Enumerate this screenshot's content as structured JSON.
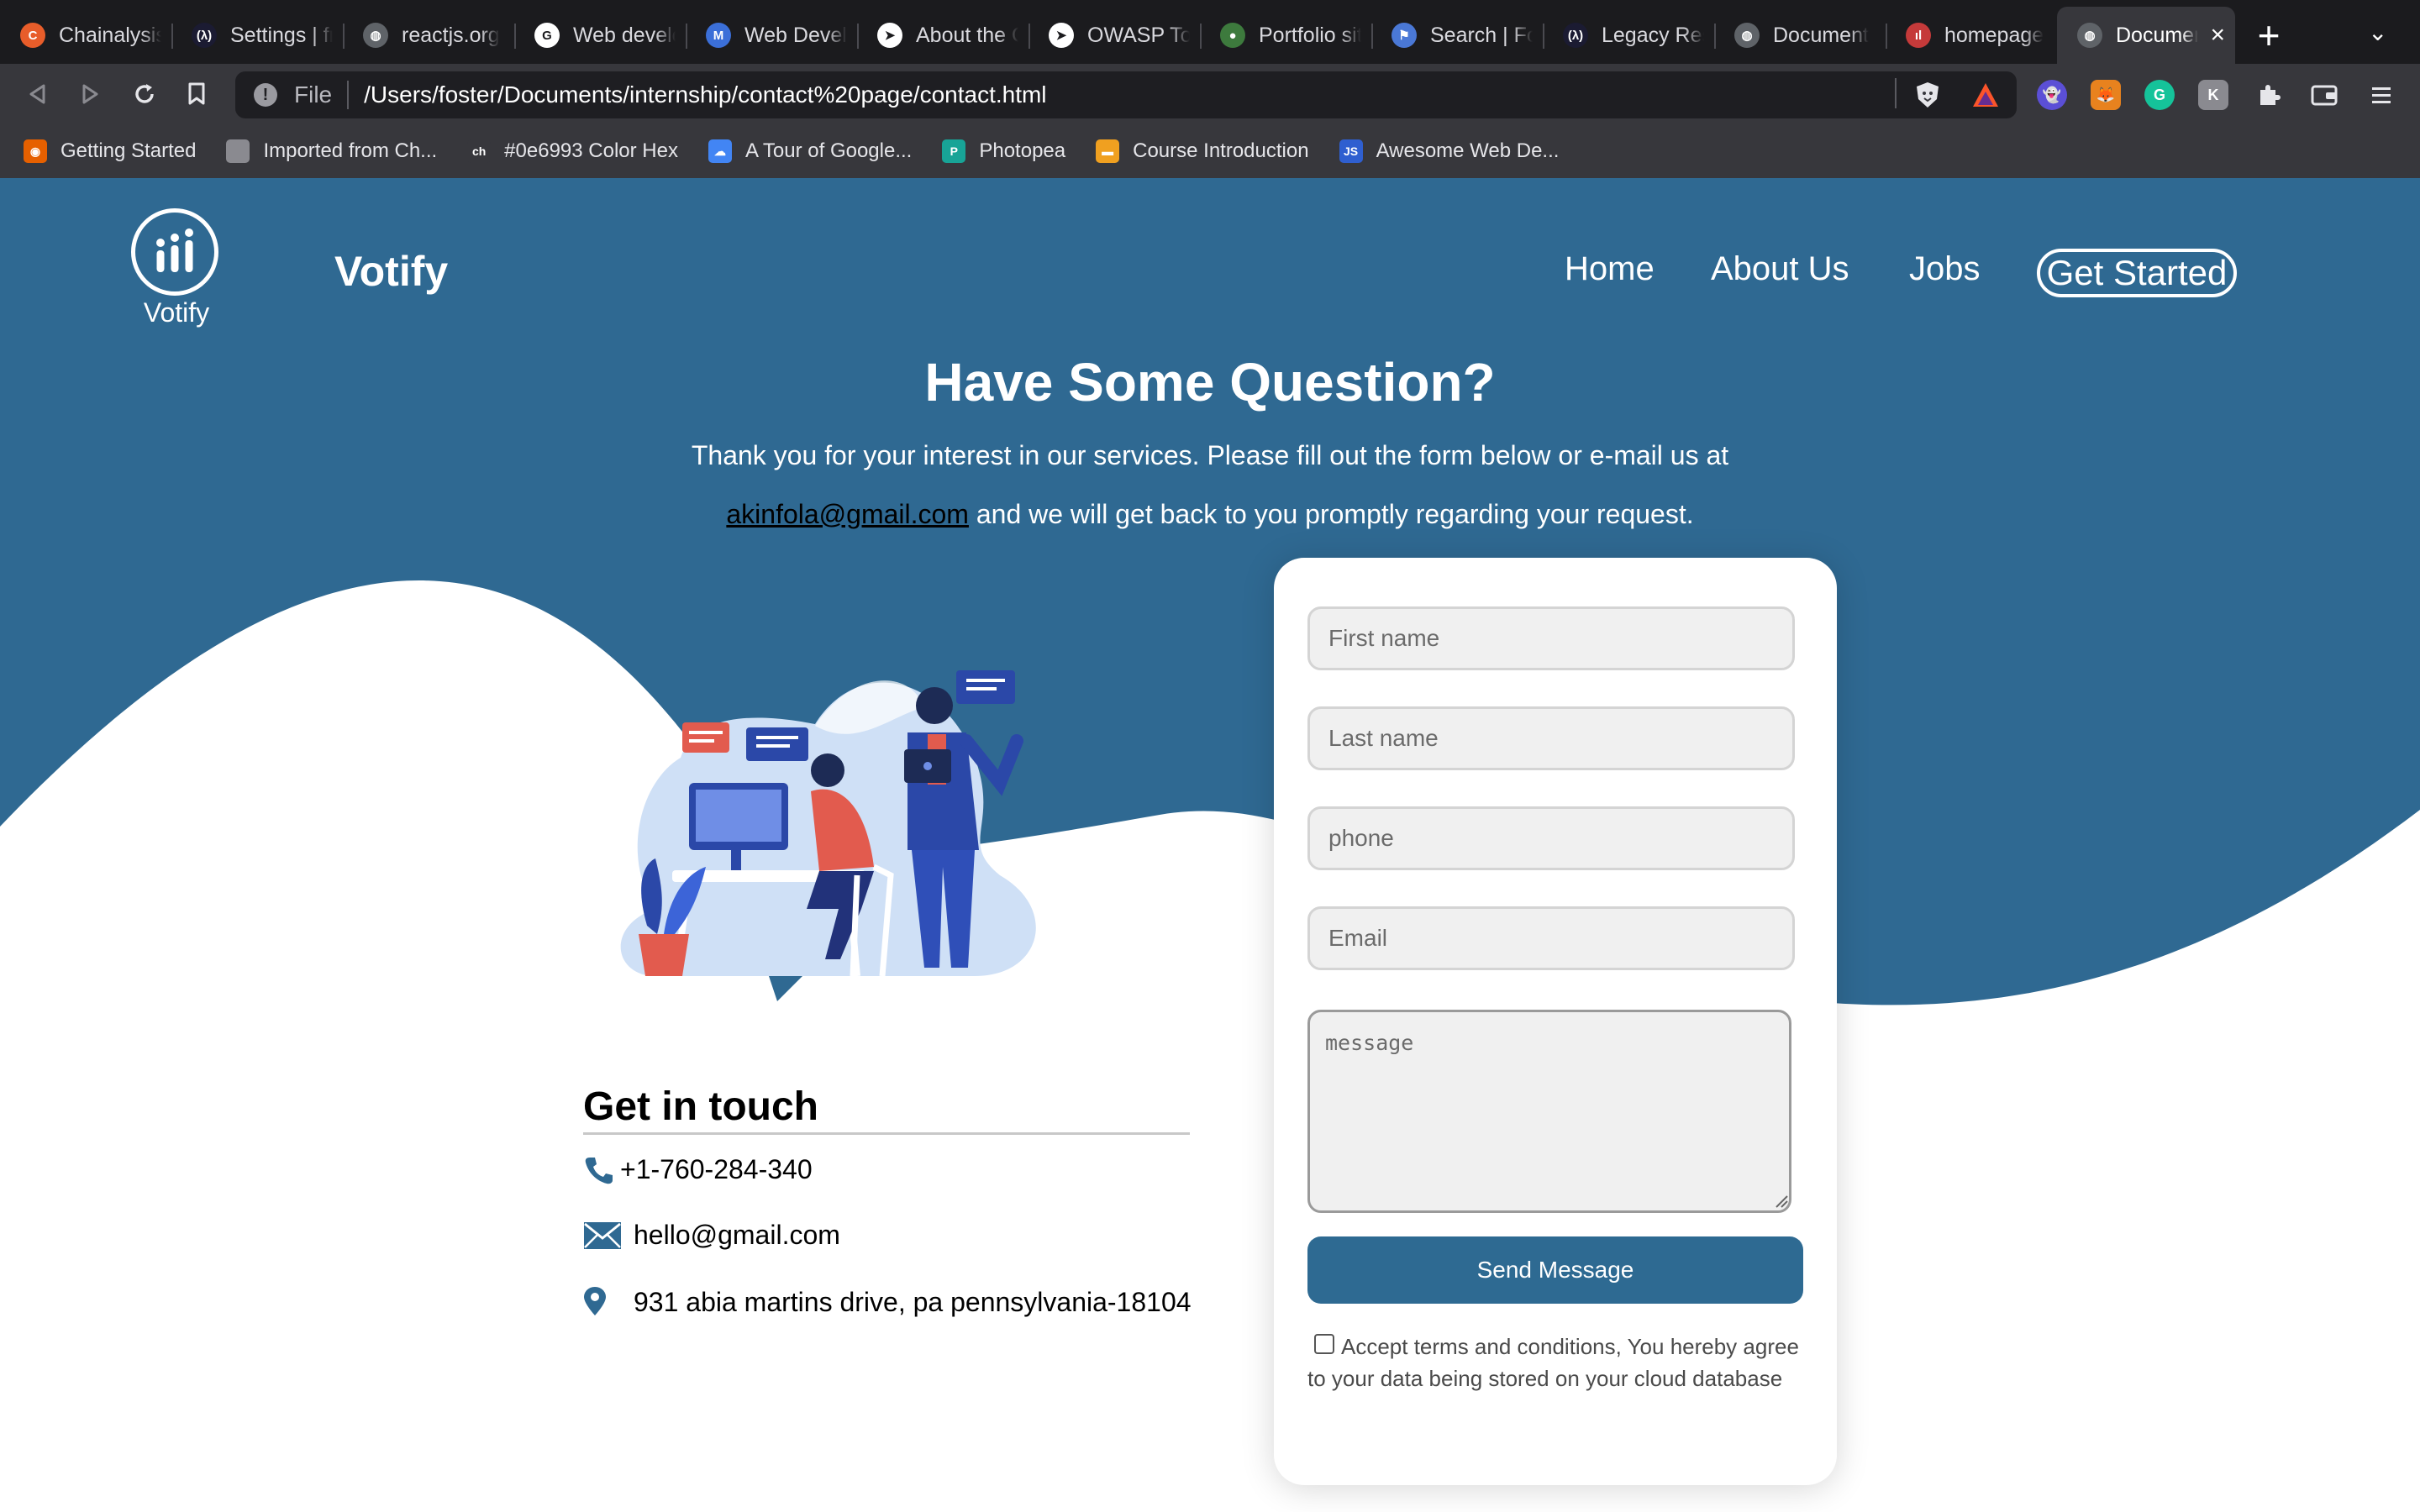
{
  "browser": {
    "tabs": [
      {
        "label": "Chainalysis",
        "icon": "chainalysis-icon",
        "color": "#e85d2a",
        "glyph": "C"
      },
      {
        "label": "Settings | fr",
        "icon": "freecodecamp-icon",
        "color": "#1b1b32",
        "glyph": "(λ)"
      },
      {
        "label": "reactjs.org",
        "icon": "globe-icon",
        "color": "#5f6368",
        "glyph": "◍"
      },
      {
        "label": "Web develo",
        "icon": "google-icon",
        "color": "#ffffff",
        "glyph": "G"
      },
      {
        "label": "Web Develo",
        "icon": "gmail-icon",
        "color": "#3b6fd8",
        "glyph": "M"
      },
      {
        "label": "About the C",
        "icon": "compass-icon",
        "color": "#ffffff",
        "glyph": "➤"
      },
      {
        "label": "OWASP Top",
        "icon": "compass-icon",
        "color": "#ffffff",
        "glyph": "➤"
      },
      {
        "label": "Portfolio sit",
        "icon": "portfolio-icon",
        "color": "#3d7a3d",
        "glyph": "●"
      },
      {
        "label": "Search | Fo",
        "icon": "flag-icon",
        "color": "#4a78d6",
        "glyph": "⚑"
      },
      {
        "label": "Legacy Res",
        "icon": "freecodecamp-icon",
        "color": "#1b1b32",
        "glyph": "(λ)"
      },
      {
        "label": "Document",
        "icon": "globe-icon",
        "color": "#5f6368",
        "glyph": "◍"
      },
      {
        "label": "homepage",
        "icon": "votify-icon",
        "color": "#c53a3a",
        "glyph": "ıl"
      },
      {
        "label": "Document",
        "icon": "globe-icon",
        "color": "#5f6368",
        "glyph": "◍",
        "active": true
      }
    ],
    "address_scheme": "File",
    "address": "/Users/foster/Documents/internship/contact%20page/contact.html",
    "bookmarks": [
      {
        "label": "Getting Started",
        "icon": "firefox-icon",
        "color": "#e66000",
        "glyph": "◉"
      },
      {
        "label": "Imported from Ch...",
        "icon": "folder-icon",
        "color": "#8a8a90",
        "glyph": ""
      },
      {
        "label": "#0e6993 Color Hex",
        "icon": "colorhex-icon",
        "color": "#37373c",
        "glyph": "ch"
      },
      {
        "label": "A Tour of Google...",
        "icon": "google-cloud-icon",
        "color": "#4285f4",
        "glyph": "☁"
      },
      {
        "label": "Photopea",
        "icon": "photopea-icon",
        "color": "#18a497",
        "glyph": "P"
      },
      {
        "label": "Course Introduction",
        "icon": "course-icon",
        "color": "#f0a020",
        "glyph": "▬"
      },
      {
        "label": "Awesome Web De...",
        "icon": "js-icon",
        "color": "#2f5fd0",
        "glyph": "JS"
      }
    ]
  },
  "site": {
    "brand": "Votify",
    "logo_caption": "Votify",
    "nav": [
      {
        "label": "Home"
      },
      {
        "label": "About Us"
      },
      {
        "label": "Jobs"
      }
    ],
    "nav_cta": "Get Started"
  },
  "hero": {
    "title": "Have Some Question?",
    "line1": "Thank you for your interest in our services. Please fill out the form below or e-mail us at",
    "email": "akinfola@gmail.com",
    "line2_rest": " and we will get back to you promptly regarding your request."
  },
  "contact": {
    "title": "Get in touch",
    "phone": "+1-760-284-340",
    "email": "hello@gmail.com",
    "address": "931 abia martins drive, pa pennsylvania-18104"
  },
  "form": {
    "first_name_placeholder": "First name",
    "last_name_placeholder": "Last name",
    "phone_placeholder": "phone",
    "email_placeholder": "Email",
    "message_placeholder": "message",
    "submit_label": "Send Message",
    "terms": "Accept terms and conditions, You hereby agree to your data being stored on your cloud database"
  },
  "colors": {
    "brand_blue": "#2f6992",
    "button_blue": "#2e6a92",
    "tabbar": "#1b1b1e",
    "toolbar": "#37373c"
  }
}
